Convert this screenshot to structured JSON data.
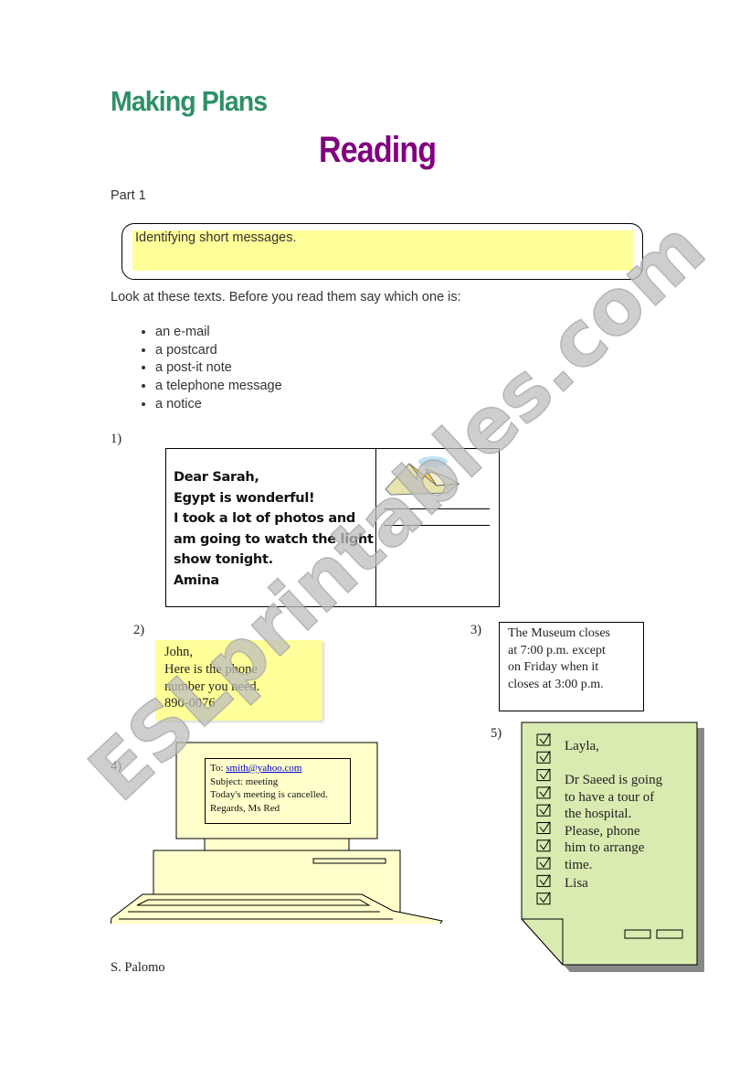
{
  "header": {
    "title": "Making Plans",
    "subtitle": "Reading"
  },
  "part_label": "Part 1",
  "objective": "Identifying short messages.",
  "instruction": "Look at these texts. Before you read them say which one is:",
  "options": [
    "an e-mail",
    "a postcard",
    "a post-it note",
    "a telephone message",
    "a notice"
  ],
  "texts": {
    "postcard": {
      "number": "1)",
      "lines": [
        "Dear Sarah,",
        "Egypt is wonderful!",
        "I took a lot of photos and",
        "am going to watch the light",
        "show tonight.",
        "Amina"
      ],
      "stamp_icon": "pyramids-stamp-icon"
    },
    "postit": {
      "number": "2)",
      "lines": [
        "John,",
        "Here is the phone",
        "number you need.",
        "890-0076"
      ],
      "color": "#ffff99"
    },
    "notice": {
      "number": "3)",
      "lines": [
        "The Museum closes",
        "at 7:00 p.m. except",
        "on Friday when it",
        "closes at 3:00 p.m."
      ]
    },
    "email": {
      "number": "4)",
      "to_label": "To:",
      "to_address": "smith@yahoo.com",
      "lines": [
        "Subject: meeting",
        "Today's meeting is cancelled.",
        "Regards, Ms Red"
      ],
      "icon": "computer-icon"
    },
    "message": {
      "number": "5)",
      "lines": [
        "Layla,",
        "",
        "Dr Saeed is going",
        "to have a tour of",
        "the hospital.",
        "Please, phone",
        "him to arrange",
        "time.",
        "Lisa"
      ],
      "color": "#d9ebb0",
      "checkbox_icon": "checked-box-icon"
    }
  },
  "author": "S. Palomo",
  "watermark": "ESLprintables.com",
  "colors": {
    "title": "#2f8f68",
    "subtitle": "#800080",
    "highlight": "#ffff99"
  }
}
